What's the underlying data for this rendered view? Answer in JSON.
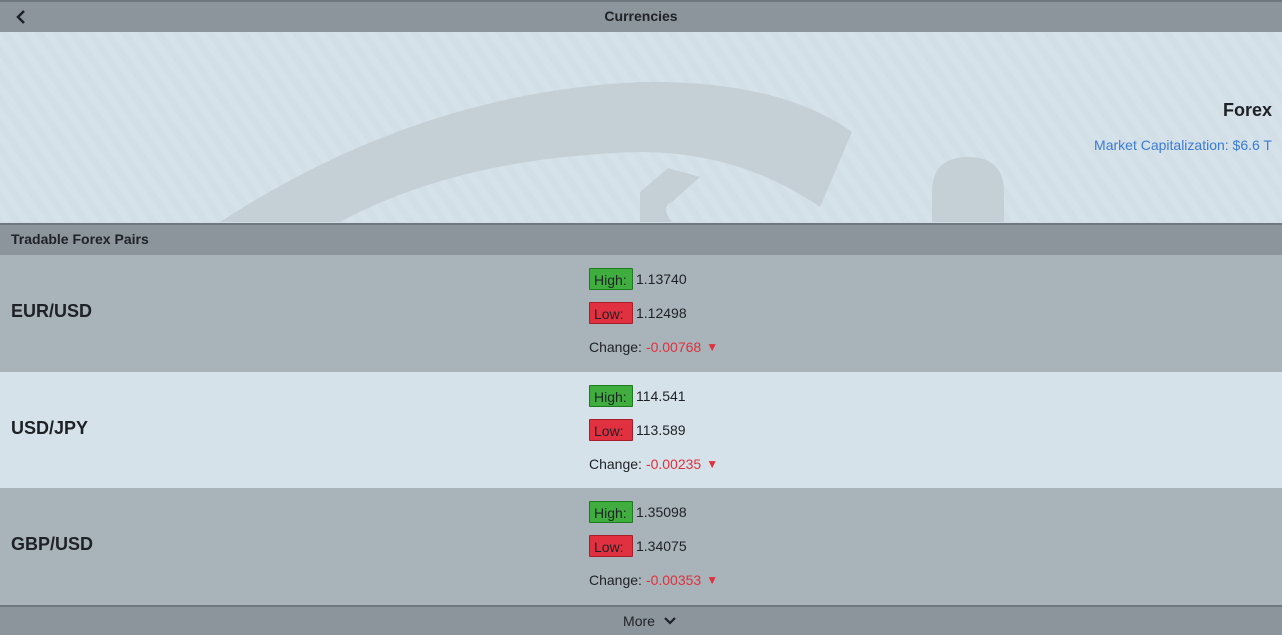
{
  "header": {
    "title": "Currencies",
    "back_icon": "chevron-left-icon"
  },
  "hero": {
    "title": "Forex",
    "market_cap": "Market Capitalization: $6.6 T"
  },
  "section": {
    "title": "Tradable Forex Pairs"
  },
  "labels": {
    "high": "High:",
    "low": "Low:",
    "change": "Change:",
    "down_arrow": "▼"
  },
  "pairs": [
    {
      "name": "EUR/USD",
      "high": "1.13740",
      "low": "1.12498",
      "change": "-0.00768"
    },
    {
      "name": "USD/JPY",
      "high": "114.541",
      "low": "113.589",
      "change": "-0.00235"
    },
    {
      "name": "GBP/USD",
      "high": "1.35098",
      "low": "1.34075",
      "change": "-0.00353"
    }
  ],
  "footer": {
    "more_label": "More",
    "more_icon": "chevron-down-icon"
  },
  "colors": {
    "high_badge": "#3fae3f",
    "low_badge": "#e1303f",
    "negative_change": "#e0303c",
    "market_cap_text": "#3a7bd5"
  }
}
